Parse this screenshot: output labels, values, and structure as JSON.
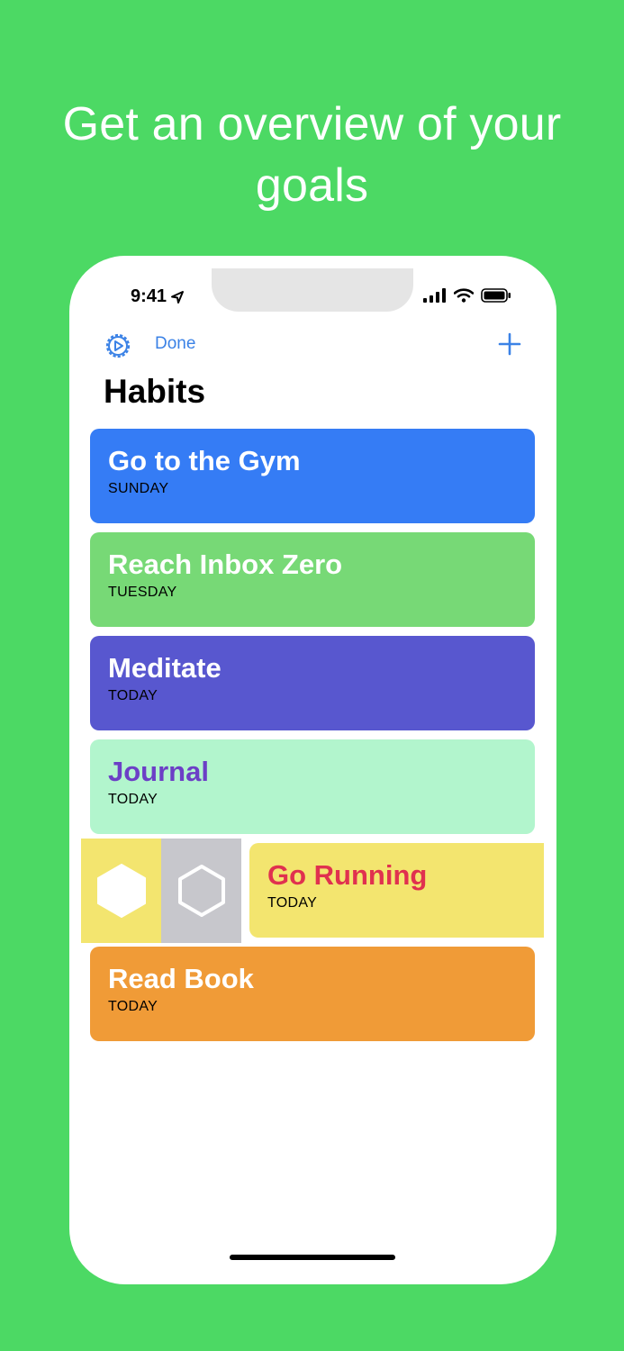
{
  "headline": "Get an overview of your goals",
  "status": {
    "time": "9:41"
  },
  "nav": {
    "done_label": "Done"
  },
  "title": "Habits",
  "habits": [
    {
      "name": "Go to the Gym",
      "day": "SUNDAY",
      "bg": "#357cf5",
      "text_color": "#ffffff"
    },
    {
      "name": "Reach Inbox Zero",
      "day": "TUESDAY",
      "bg": "#77d976",
      "text_color": "#ffffff"
    },
    {
      "name": "Meditate",
      "day": "TODAY",
      "bg": "#5857cf",
      "text_color": "#ffffff"
    },
    {
      "name": "Journal",
      "day": "TODAY",
      "bg": "#b2f5cd",
      "text_color": "#6c3fc6"
    },
    {
      "name": "Go Running",
      "day": "TODAY",
      "bg": "#f3e56f",
      "text_color": "#e0314f"
    },
    {
      "name": "Read Book",
      "day": "TODAY",
      "bg": "#f09b37",
      "text_color": "#ffffff"
    }
  ],
  "swipe_actions": [
    {
      "icon": "filled-hexagon-icon",
      "bg": "#f3e56f"
    },
    {
      "icon": "outline-hexagon-icon",
      "bg": "#c7c7cc"
    }
  ],
  "colors": {
    "background": "#4cd964",
    "accent": "#3b82e6"
  }
}
